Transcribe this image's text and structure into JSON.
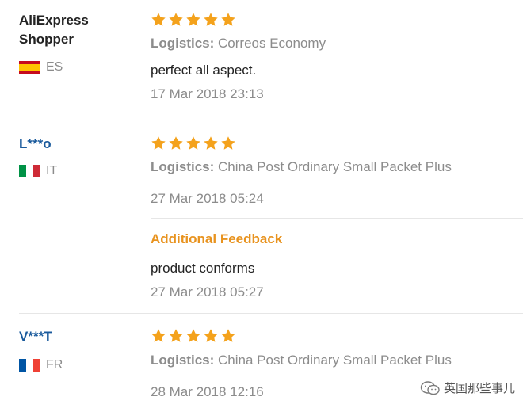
{
  "reviews": [
    {
      "user": "AliExpress Shopper",
      "user_line1": "AliExpress",
      "user_line2": "Shopper",
      "country_code": "ES",
      "flag": "spain-flag",
      "rating": 5,
      "logistics_label": "Logistics:",
      "logistics_value": "Correos Economy",
      "feedback": "perfect all aspect.",
      "date": "17 Mar 2018 23:13"
    },
    {
      "user": "L***o",
      "country_code": "IT",
      "flag": "italy-flag",
      "rating": 5,
      "logistics_label": "Logistics:",
      "logistics_value": "China Post Ordinary Small Packet Plus",
      "date": "27 Mar 2018 05:24",
      "additional_title": "Additional Feedback",
      "additional_feedback": "product conforms",
      "additional_date": "27 Mar 2018 05:27"
    },
    {
      "user": "V***T",
      "country_code": "FR",
      "flag": "france-flag",
      "rating": 5,
      "logistics_label": "Logistics:",
      "logistics_value": "China Post Ordinary Small Packet Plus",
      "date": "28 Mar 2018 12:16"
    }
  ],
  "watermark": "英国那些事儿",
  "colors": {
    "star": "#f4a21c",
    "link": "#1a5a9c",
    "accent": "#e8931f",
    "muted": "#8c8c8c",
    "text": "#222222"
  }
}
